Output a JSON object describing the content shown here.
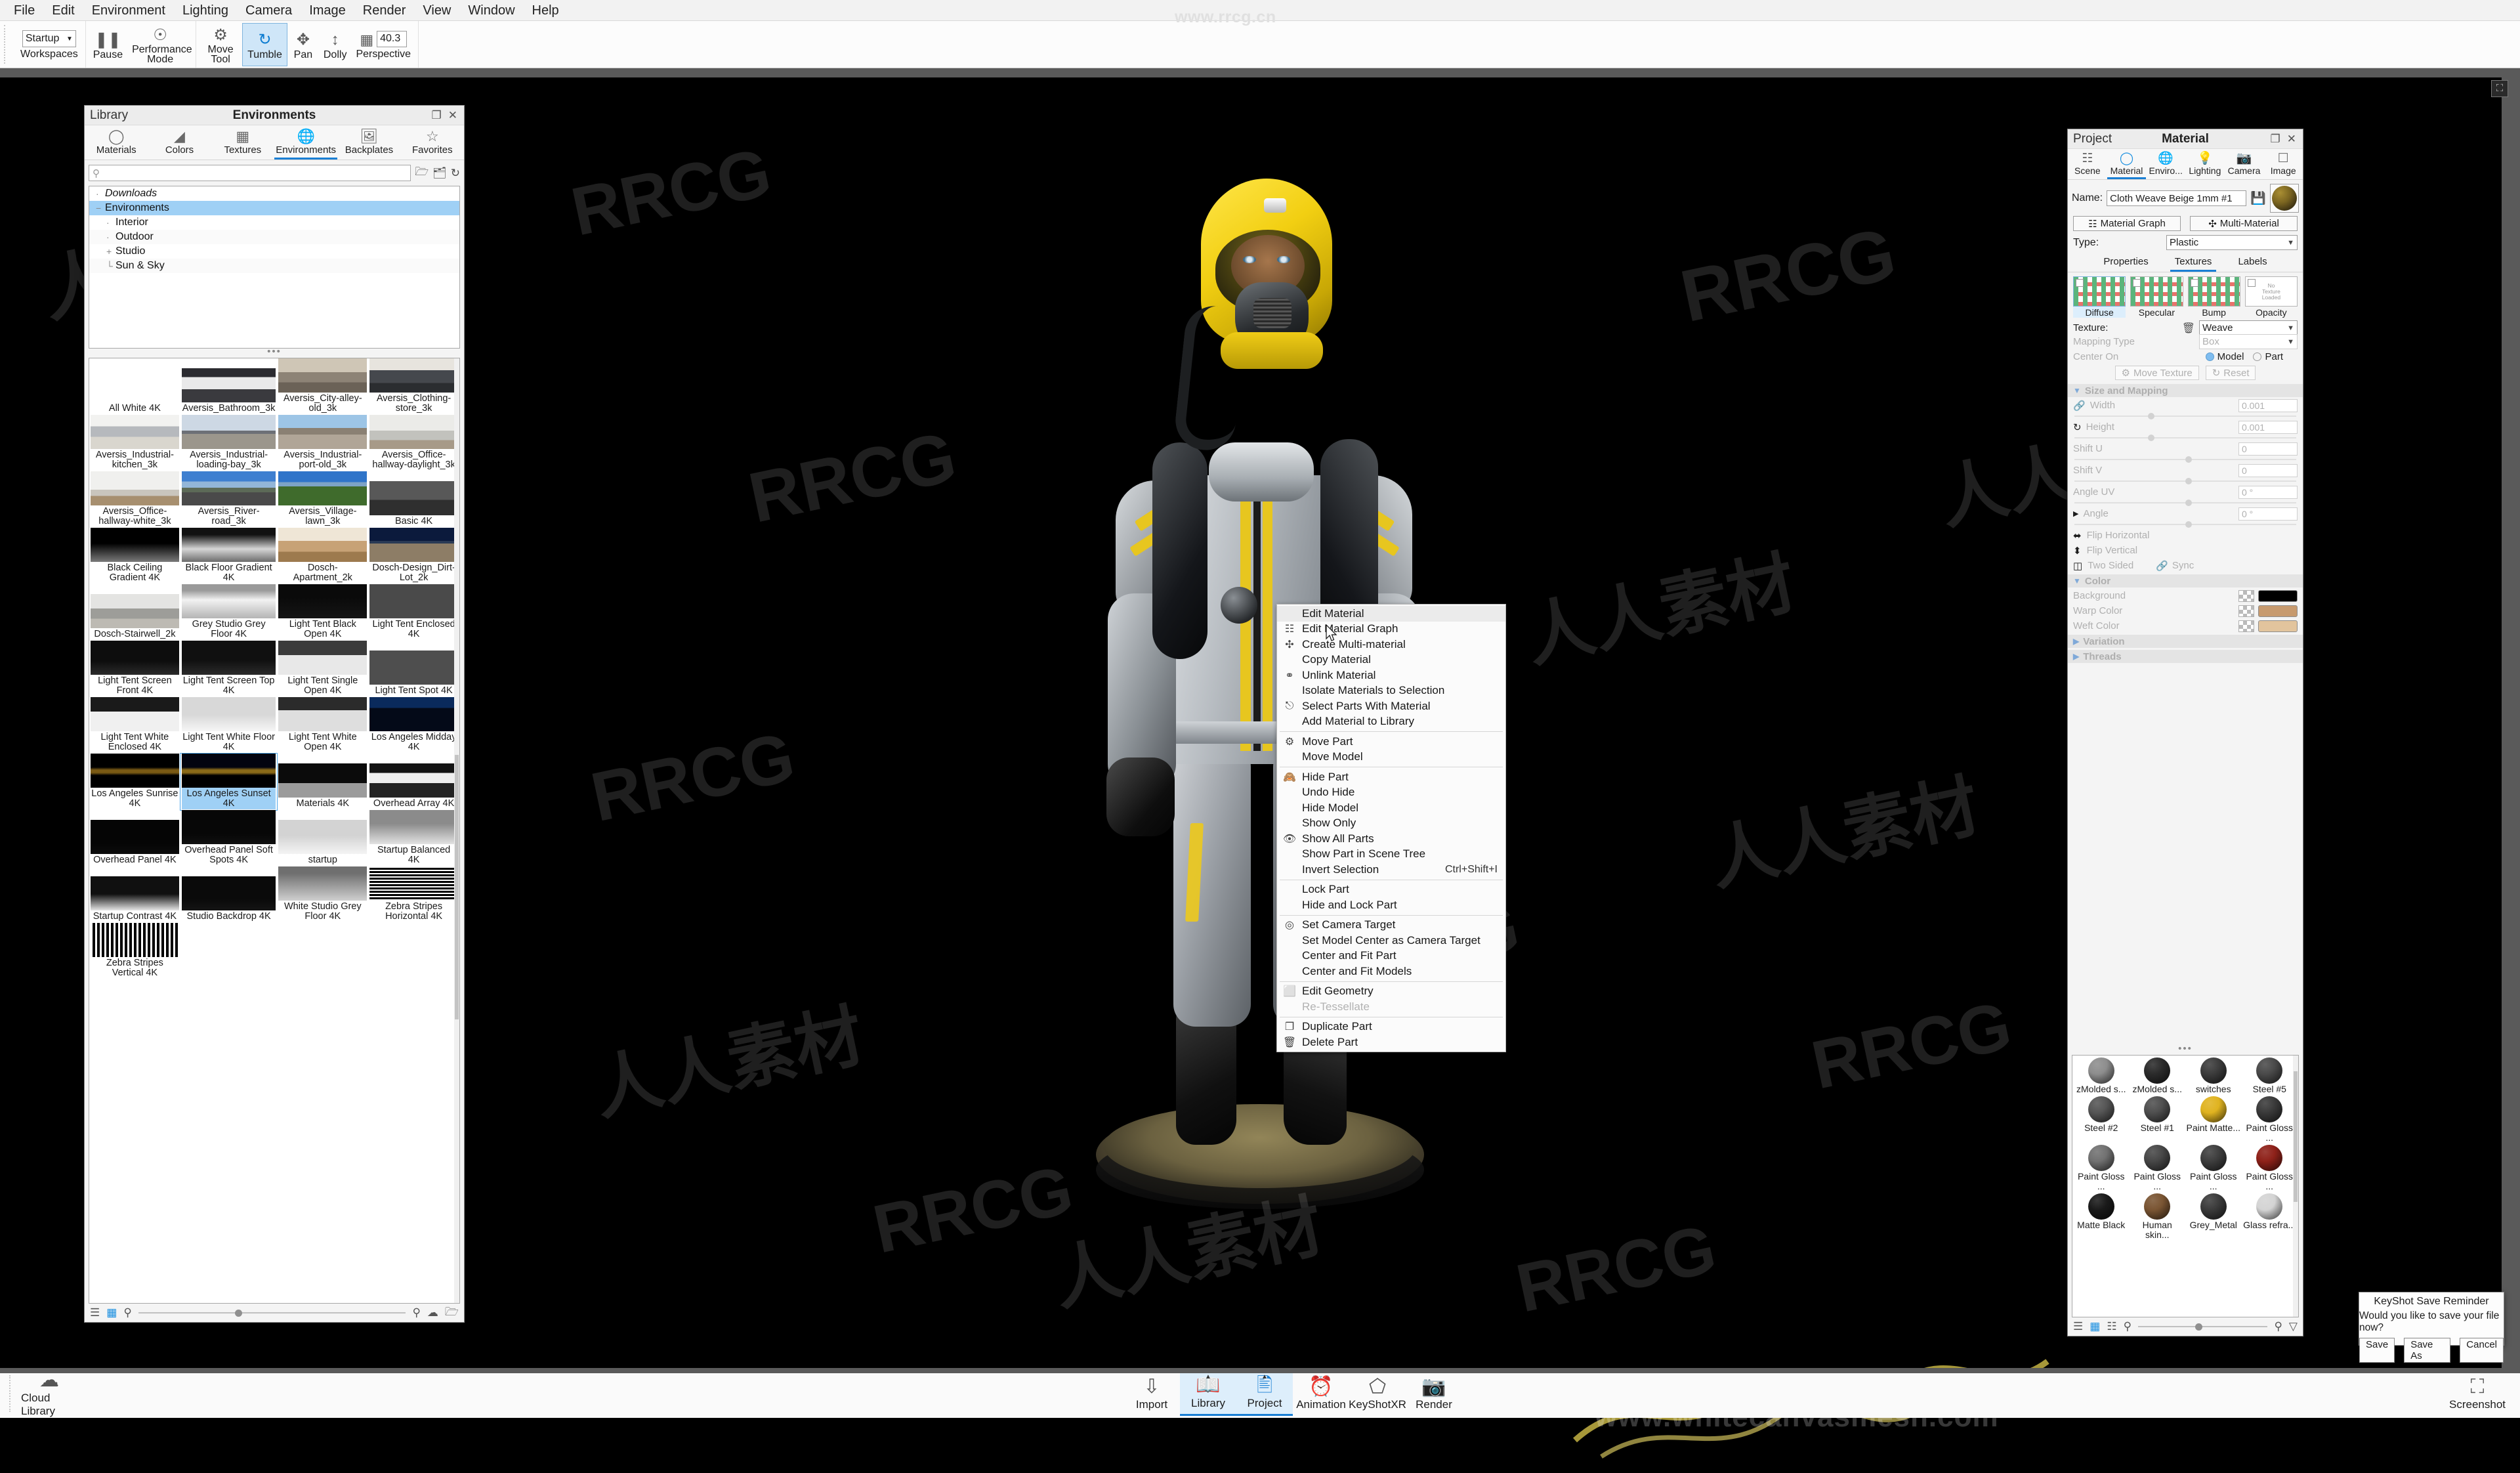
{
  "watermarks": {
    "top_url": "www.rrcg.cn",
    "bottom_url": "www.whitecanvasmesh.com",
    "tiles": [
      "RRCG",
      "人人素材"
    ]
  },
  "menubar": {
    "items": [
      "File",
      "Edit",
      "Environment",
      "Lighting",
      "Camera",
      "Image",
      "Render",
      "View",
      "Window",
      "Help"
    ]
  },
  "toolbar": {
    "workspace_value": "Startup",
    "workspace_caption": "Workspaces",
    "pause_caption": "Pause",
    "performance_caption": "Performance Mode",
    "move_tool_caption": "Move Tool",
    "tumble_caption": "Tumble",
    "pan_caption": "Pan",
    "dolly_caption": "Dolly",
    "perspective_caption": "Perspective",
    "perspective_value": "40.3"
  },
  "library": {
    "header_left": "Library",
    "header_title": "Environments",
    "tabs": [
      {
        "label": "Materials",
        "icon": "material-ball-icon"
      },
      {
        "label": "Colors",
        "icon": "color-swatch-icon"
      },
      {
        "label": "Textures",
        "icon": "checker-icon"
      },
      {
        "label": "Environments",
        "icon": "globe-icon"
      },
      {
        "label": "Backplates",
        "icon": "picture-icon"
      },
      {
        "label": "Favorites",
        "icon": "star-icon"
      }
    ],
    "selected_tab": "Environments",
    "search_placeholder": "",
    "tree": [
      {
        "label": "Downloads",
        "indent": 0,
        "twisty": "·",
        "italic": true,
        "selected": false
      },
      {
        "label": "Environments",
        "indent": 0,
        "twisty": "−",
        "italic": false,
        "selected": true
      },
      {
        "label": "Interior",
        "indent": 1,
        "twisty": "·",
        "italic": false,
        "selected": false
      },
      {
        "label": "Outdoor",
        "indent": 1,
        "twisty": "·",
        "italic": false,
        "selected": false
      },
      {
        "label": "Studio",
        "indent": 1,
        "twisty": "+",
        "italic": false,
        "selected": false
      },
      {
        "label": "Sun & Sky",
        "indent": 1,
        "twisty": "└",
        "italic": false,
        "selected": false
      }
    ],
    "environments": [
      {
        "name": "All White 4K",
        "kind": "white"
      },
      {
        "name": "Aversis_Bathroom_3k",
        "kind": "bathroom"
      },
      {
        "name": "Aversis_City-alley-old_3k",
        "kind": "alley"
      },
      {
        "name": "Aversis_Clothing-store_3k",
        "kind": "store"
      },
      {
        "name": "Aversis_Industrial-kitchen_3k",
        "kind": "kitchen"
      },
      {
        "name": "Aversis_Industrial-loading-bay_3k",
        "kind": "loadingbay"
      },
      {
        "name": "Aversis_Industrial-port-old_3k",
        "kind": "port"
      },
      {
        "name": "Aversis_Office-hallway-daylight_3k",
        "kind": "hallway"
      },
      {
        "name": "Aversis_Office-hallway-white_3k",
        "kind": "hallwaywhite"
      },
      {
        "name": "Aversis_River-road_3k",
        "kind": "riverroad"
      },
      {
        "name": "Aversis_Village-lawn_3k",
        "kind": "lawn"
      },
      {
        "name": "Basic 4K",
        "kind": "basic"
      },
      {
        "name": "Black Ceiling Gradient 4K",
        "kind": "blackceil"
      },
      {
        "name": "Black Floor Gradient 4K",
        "kind": "blackfloor"
      },
      {
        "name": "Dosch-Apartment_2k",
        "kind": "apartment"
      },
      {
        "name": "Dosch-Design_Dirt-Lot_2k",
        "kind": "dirtlot"
      },
      {
        "name": "Dosch-Stairwell_2k",
        "kind": "stairwell"
      },
      {
        "name": "Grey Studio Grey Floor 4K",
        "kind": "greystudio"
      },
      {
        "name": "Light Tent Black Open 4K",
        "kind": "tentblackopen"
      },
      {
        "name": "Light Tent Enclosed 4K",
        "kind": "tentenclosed"
      },
      {
        "name": "Light Tent Screen Front 4K",
        "kind": "tentscreenfront"
      },
      {
        "name": "Light Tent Screen Top 4K",
        "kind": "tentscreentop"
      },
      {
        "name": "Light Tent Single Open 4K",
        "kind": "tentsingle"
      },
      {
        "name": "Light Tent Spot 4K",
        "kind": "tentspot"
      },
      {
        "name": "Light Tent White Enclosed 4K",
        "kind": "tentwhiteenc"
      },
      {
        "name": "Light Tent White Floor 4K",
        "kind": "tentwhitefloor"
      },
      {
        "name": "Light Tent White Open 4K",
        "kind": "tentwhiteopen"
      },
      {
        "name": "Los Angeles Midday 4K",
        "kind": "lamidday"
      },
      {
        "name": "Los Angeles Sunrise 4K",
        "kind": "lasunrise"
      },
      {
        "name": "Los Angeles Sunset 4K",
        "kind": "lasunset",
        "selected": true
      },
      {
        "name": "Materials 4K",
        "kind": "materials"
      },
      {
        "name": "Overhead Array 4K",
        "kind": "oharray"
      },
      {
        "name": "Overhead Panel 4K",
        "kind": "ohpanel"
      },
      {
        "name": "Overhead Panel Soft Spots 4K",
        "kind": "ohsoft"
      },
      {
        "name": "startup",
        "kind": "startup"
      },
      {
        "name": "Startup Balanced 4K",
        "kind": "startupbal"
      },
      {
        "name": "Startup Contrast 4K",
        "kind": "startupcon"
      },
      {
        "name": "Studio Backdrop 4K",
        "kind": "backdrop"
      },
      {
        "name": "White Studio Grey Floor 4K",
        "kind": "whitestudio"
      },
      {
        "name": "Zebra Stripes Horizontal 4K",
        "kind": "zebrah"
      },
      {
        "name": "Zebra Stripes Vertical 4K",
        "kind": "zebrav"
      }
    ]
  },
  "context_menu": {
    "items": [
      {
        "label": "Edit Material",
        "icon": "",
        "highlight": true
      },
      {
        "label": "Edit Material Graph",
        "icon": "node-graph-icon"
      },
      {
        "label": "Create Multi-material",
        "icon": "multi-material-icon"
      },
      {
        "label": "Copy Material",
        "icon": ""
      },
      {
        "label": "Unlink Material",
        "icon": "unlink-icon"
      },
      {
        "label": "Isolate Materials to Selection",
        "icon": ""
      },
      {
        "label": "Select Parts With Material",
        "icon": "select-parts-icon"
      },
      {
        "label": "Add Material to Library",
        "icon": ""
      },
      {
        "separator": true
      },
      {
        "label": "Move Part",
        "icon": "move-gizmo-icon"
      },
      {
        "label": "Move Model",
        "icon": ""
      },
      {
        "separator": true
      },
      {
        "label": "Hide Part",
        "icon": "eye-slash-icon"
      },
      {
        "label": "Undo Hide",
        "icon": ""
      },
      {
        "label": "Hide Model",
        "icon": ""
      },
      {
        "label": "Show Only",
        "icon": ""
      },
      {
        "label": "Show All Parts",
        "icon": "eye-icon"
      },
      {
        "label": "Show Part in Scene Tree",
        "icon": ""
      },
      {
        "label": "Invert Selection",
        "icon": "",
        "shortcut": "Ctrl+Shift+I"
      },
      {
        "separator": true
      },
      {
        "label": "Lock Part",
        "icon": ""
      },
      {
        "label": "Hide and Lock Part",
        "icon": ""
      },
      {
        "separator": true
      },
      {
        "label": "Set Camera Target",
        "icon": "target-icon"
      },
      {
        "label": "Set Model Center as Camera Target",
        "icon": ""
      },
      {
        "label": "Center and Fit Part",
        "icon": ""
      },
      {
        "label": "Center and Fit Models",
        "icon": ""
      },
      {
        "separator": true
      },
      {
        "label": "Edit Geometry",
        "icon": "cube-icon"
      },
      {
        "label": "Re-Tessellate",
        "icon": "",
        "disabled": true
      },
      {
        "separator": true
      },
      {
        "label": "Duplicate Part",
        "icon": "duplicate-icon"
      },
      {
        "label": "Delete Part",
        "icon": "trash-icon"
      }
    ]
  },
  "project": {
    "header_left": "Project",
    "header_title": "Material",
    "tabs": [
      {
        "label": "Scene",
        "icon": "scene-tree-icon"
      },
      {
        "label": "Material",
        "icon": "material-ball-icon"
      },
      {
        "label": "Enviro...",
        "icon": "globe-icon"
      },
      {
        "label": "Lighting",
        "icon": "bulb-icon"
      },
      {
        "label": "Camera",
        "icon": "camera-icon"
      },
      {
        "label": "Image",
        "icon": "frame-icon"
      }
    ],
    "selected_tab": "Material",
    "name_label": "Name:",
    "name_value": "Cloth Weave Beige 1mm #1",
    "material_graph_button": "Material Graph",
    "multi_material_button": "Multi-Material",
    "type_label": "Type:",
    "type_value": "Plastic",
    "subtabs": [
      "Properties",
      "Textures",
      "Labels"
    ],
    "selected_subtab": "Textures",
    "texture_slots": [
      {
        "label": "Diffuse",
        "selected": true,
        "loaded": true
      },
      {
        "label": "Specular",
        "selected": false,
        "loaded": true
      },
      {
        "label": "Bump",
        "selected": false,
        "loaded": true
      },
      {
        "label": "Opacity",
        "selected": false,
        "loaded": false,
        "empty_text": "No Texture Loaded"
      }
    ],
    "texture_label": "Texture:",
    "texture_value": "Weave",
    "mapping_type_label": "Mapping Type",
    "mapping_type_value": "Box",
    "center_on_label": "Center On",
    "center_on_options": [
      "Model",
      "Part"
    ],
    "center_on_selected": "Model",
    "move_texture_button": "Move Texture",
    "reset_button": "Reset",
    "size_section": "Size and Mapping",
    "params": [
      {
        "label": "Width",
        "value": "0.001",
        "knob": 0.33
      },
      {
        "label": "Height",
        "value": "0.001",
        "knob": 0.33
      },
      {
        "label": "Shift U",
        "value": "0",
        "knob": 0.5
      },
      {
        "label": "Shift V",
        "value": "0",
        "knob": 0.5
      },
      {
        "label": "Angle UV",
        "value": "0 °",
        "knob": 0.5
      },
      {
        "label": "Angle",
        "value": "0 °",
        "knob": 0.5
      }
    ],
    "flip_horizontal": "Flip Horizontal",
    "flip_vertical": "Flip Vertical",
    "two_sided": "Two Sided",
    "sync": "Sync",
    "color_section": "Color",
    "colors": [
      {
        "label": "Background",
        "hex": "#000000"
      },
      {
        "label": "Warp Color",
        "hex": "#c79a6e"
      },
      {
        "label": "Weft Color",
        "hex": "#e2c49d"
      }
    ],
    "variation_section": "Variation",
    "threads_section": "Threads",
    "materials": [
      {
        "name": "zMolded s...",
        "hex": "#8d8d8d"
      },
      {
        "name": "zMolded s...",
        "hex": "#2b2b2b"
      },
      {
        "name": "switches",
        "hex": "#3c3c3c"
      },
      {
        "name": "Steel #5",
        "hex": "#4a4a4a"
      },
      {
        "name": "Steel #2",
        "hex": "#555555"
      },
      {
        "name": "Steel #1",
        "hex": "#4f4f4f"
      },
      {
        "name": "Paint Matte...",
        "hex": "#e0b320"
      },
      {
        "name": "Paint Gloss ...",
        "hex": "#3a3a3a"
      },
      {
        "name": "Paint Gloss ...",
        "hex": "#717171"
      },
      {
        "name": "Paint Gloss ...",
        "hex": "#474747"
      },
      {
        "name": "Paint Gloss ...",
        "hex": "#3e3e3e"
      },
      {
        "name": "Paint Gloss ...",
        "hex": "#8e2119"
      },
      {
        "name": "Matte Black",
        "hex": "#1a1a1a"
      },
      {
        "name": "Human skin...",
        "hex": "#7a5533"
      },
      {
        "name": "Grey_Metal",
        "hex": "#3b3b3b"
      },
      {
        "name": "Glass refra...",
        "hex": "#d4d4d4"
      }
    ]
  },
  "save_dialog": {
    "title": "KeyShot Save Reminder",
    "message": "Would you like to save your file now?",
    "buttons": [
      "Save",
      "Save As",
      "Cancel"
    ]
  },
  "dock": {
    "cloud_library": "Cloud Library",
    "items": [
      {
        "label": "Import",
        "icon": "import-icon",
        "selected": false
      },
      {
        "label": "Library",
        "icon": "book-icon",
        "selected": true
      },
      {
        "label": "Project",
        "icon": "document-icon",
        "selected": true
      },
      {
        "label": "Animation",
        "icon": "animation-icon",
        "selected": false
      },
      {
        "label": "KeyShotXR",
        "icon": "xr-cube-icon",
        "selected": false
      },
      {
        "label": "Render",
        "icon": "render-camera-icon",
        "selected": false
      }
    ],
    "screenshot": "Screenshot"
  }
}
